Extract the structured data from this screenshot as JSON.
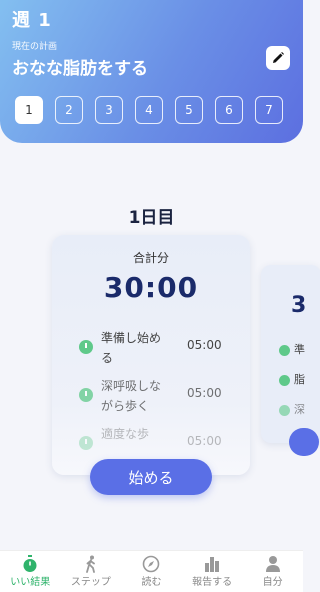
{
  "header": {
    "week_title": "週 1",
    "plan_label": "現在の計画",
    "plan_name": "おなな脂肪をする",
    "days": [
      "1",
      "2",
      "3",
      "4",
      "5",
      "6",
      "7"
    ],
    "selected_day": "1"
  },
  "main": {
    "day_heading": "1日目",
    "card": {
      "total_label": "合計分",
      "total_time": "30:00",
      "steps": [
        {
          "name": "準備し始める",
          "time": "05:00"
        },
        {
          "name": "深呼吸しながら歩く",
          "time": "05:00"
        },
        {
          "name": "適度な歩",
          "time": "05:00"
        }
      ]
    },
    "side_card": {
      "total_time_partial": "3",
      "steps_partial": [
        "準",
        "脂",
        "深"
      ]
    },
    "start_label": "始める"
  },
  "tabbar": {
    "items": [
      {
        "label": "いい結果",
        "icon": "timer-icon",
        "active": true
      },
      {
        "label": "ステップ",
        "icon": "walking-icon",
        "active": false
      },
      {
        "label": "読む",
        "icon": "compass-icon",
        "active": false
      },
      {
        "label": "報告する",
        "icon": "bar-chart-icon",
        "active": false
      },
      {
        "label": "自分",
        "icon": "person-icon",
        "active": false
      }
    ]
  },
  "colors": {
    "accent": "#5a6fe6",
    "active_tab": "#2fb36b",
    "clock_green": "#5fc98a"
  }
}
